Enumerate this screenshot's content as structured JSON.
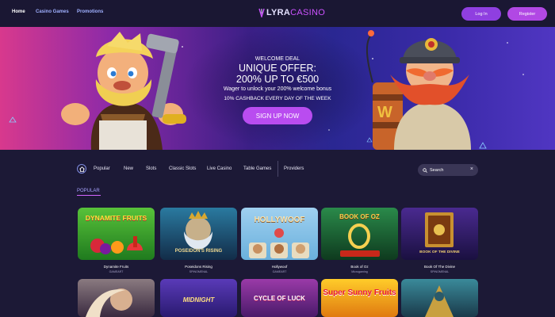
{
  "header": {
    "nav": [
      "Home",
      "Casino Games",
      "Promotions"
    ],
    "logo_part1": "LYRA",
    "logo_part2": "CASINO",
    "login_label": "Log In",
    "register_label": "Register"
  },
  "hero": {
    "welcome": "WELCOME DEAL",
    "unique": "UNIQUE OFFER:",
    "amount": "200% UP TO €500",
    "wager": "Wager to unlock your 200% welcome bonus",
    "cashback": "10% CASHBACK EVERY DAY OF THE WEEK",
    "cta": "SIGN UP NOW"
  },
  "categories": [
    "Popular",
    "New",
    "Slots",
    "Classic Slots",
    "Live Casino",
    "Table Games",
    "Providers"
  ],
  "search": {
    "value": "Search"
  },
  "section": {
    "title": "POPULAR"
  },
  "games": [
    {
      "name": "Dynamite Fruits",
      "provider": "GAMEART",
      "art_title": "DYNAMITE FRUITS",
      "bg": "#2f9a2a"
    },
    {
      "name": "Poseidons Rising",
      "provider": "SPINOMENAL",
      "art_title": "POSEIDON'S RISING",
      "bg": "#1e4f6e"
    },
    {
      "name": "Hollywoof",
      "provider": "GAMEART",
      "art_title": "HOLLYWOOF",
      "bg": "#87c4ea"
    },
    {
      "name": "Book of Oz",
      "provider": "Microgaming",
      "art_title": "BOOK OF OZ",
      "bg": "#1f6b3a"
    },
    {
      "name": "Book Of The Divine",
      "provider": "SPINOMENAL",
      "art_title": "BOOK OF THE DIVINE",
      "bg": "#3a2070"
    }
  ],
  "games_row2": [
    {
      "art_title": "",
      "bg": "#6a5a63"
    },
    {
      "art_title": "MIDNIGHT",
      "bg": "#4b3aa6"
    },
    {
      "art_title": "CYCLE OF LUCK",
      "bg": "#7d2c8e"
    },
    {
      "art_title": "Super Sunny Fruits",
      "bg": "#f0a21a"
    },
    {
      "art_title": "",
      "bg": "#2e6a7a"
    }
  ],
  "colors": {
    "accent": "#b148e4",
    "background": "#1c1936",
    "link": "#9fb0ff"
  }
}
